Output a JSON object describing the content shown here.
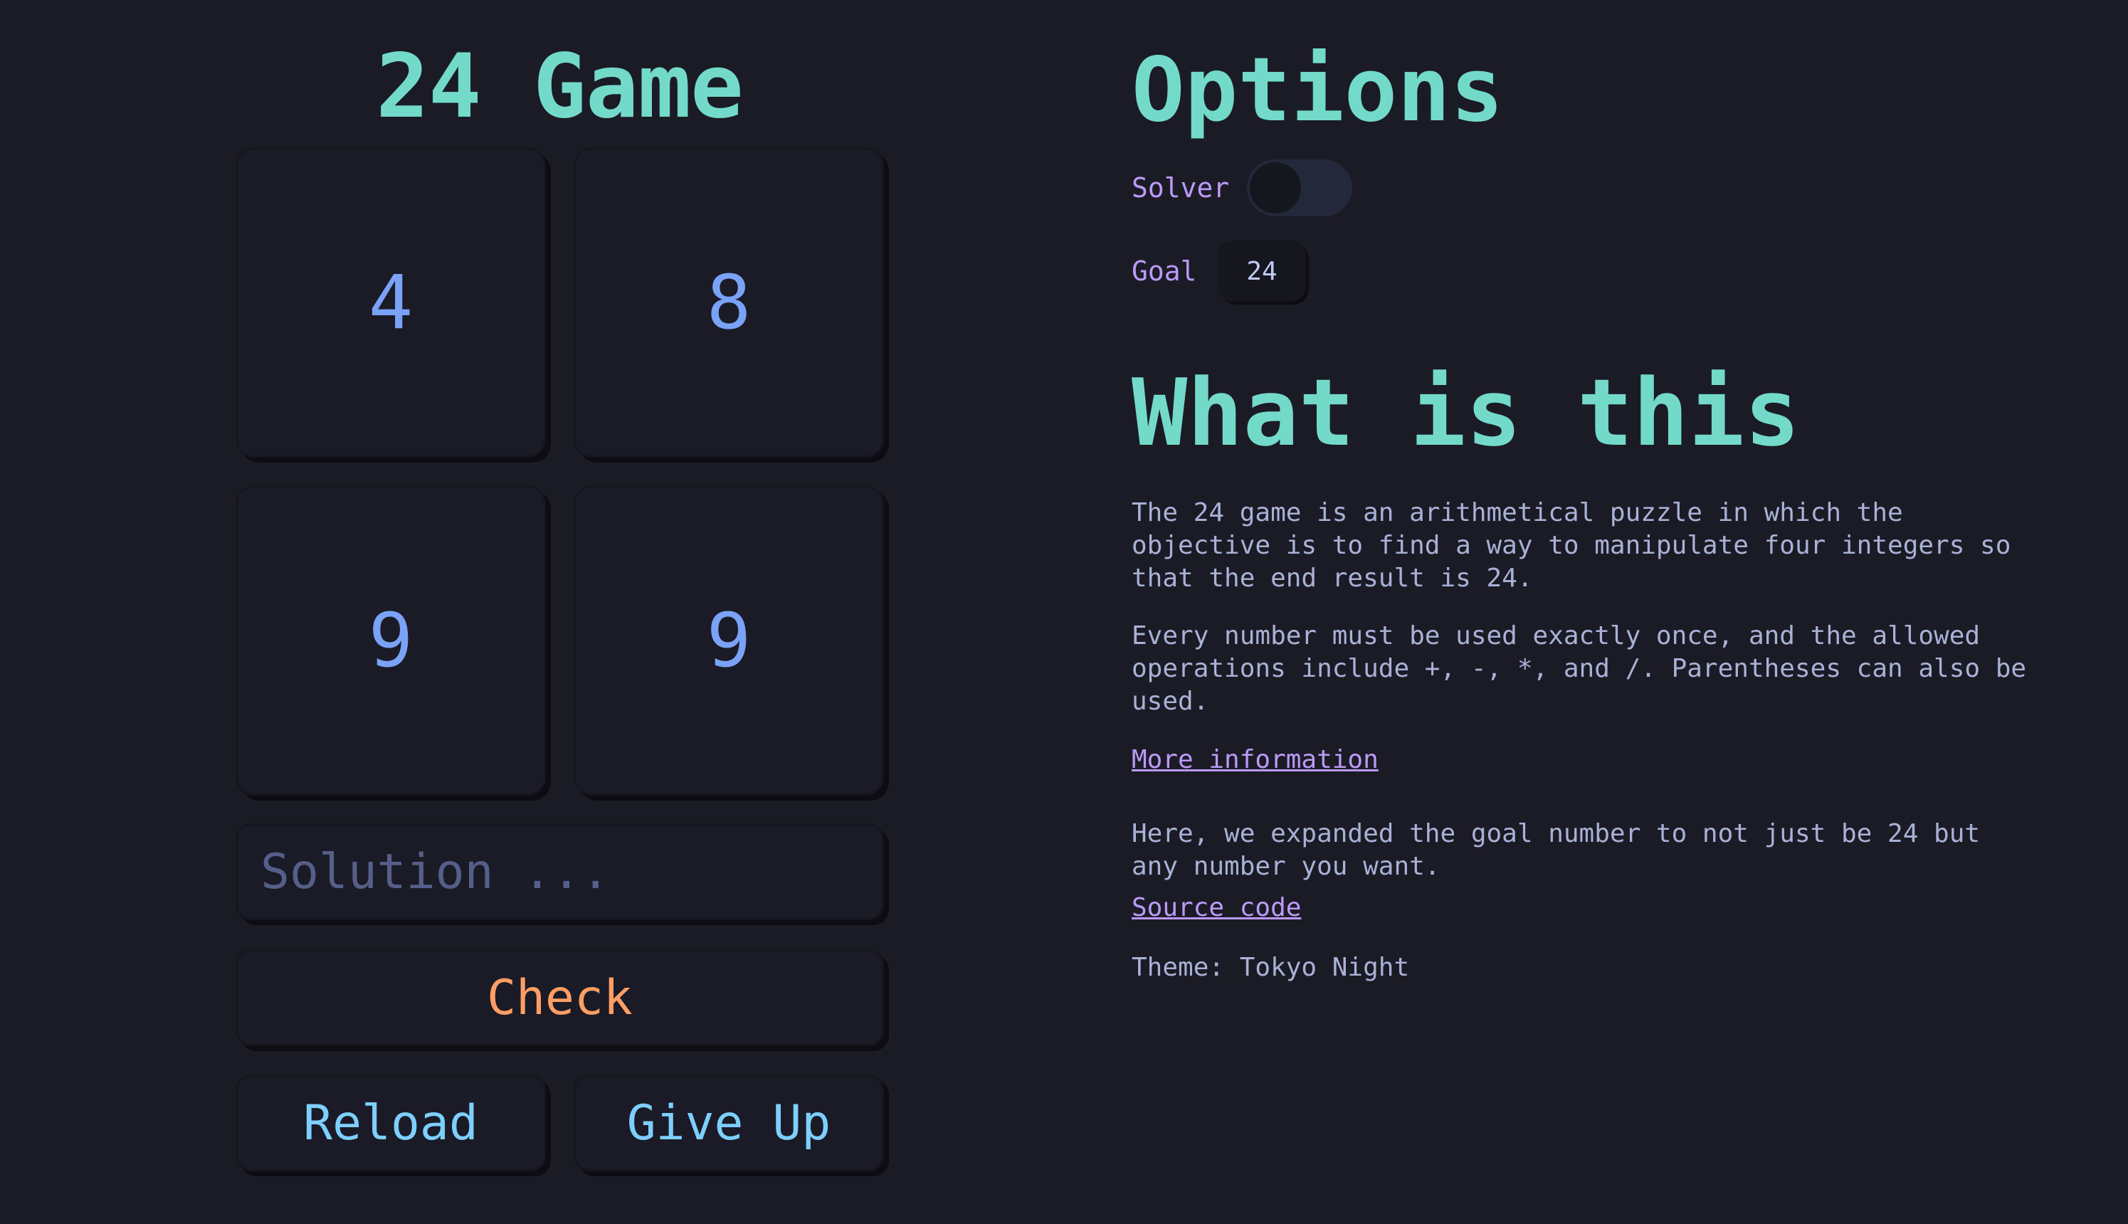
{
  "game": {
    "title": "24 Game",
    "cards": [
      "4",
      "8",
      "9",
      "9"
    ],
    "solution_placeholder": "Solution ...",
    "solution_value": "",
    "check_label": "Check",
    "reload_label": "Reload",
    "giveup_label": "Give Up"
  },
  "options": {
    "title": "Options",
    "solver_label": "Solver",
    "solver_enabled": false,
    "goal_label": "Goal",
    "goal_value": "24"
  },
  "about": {
    "title": "What is this",
    "paragraph1": "The 24 game is an arithmetical puzzle in which the objective is to find a way to manipulate four integers so that the end result is 24.",
    "paragraph2": "Every number must be used exactly once, and the allowed operations include +, -, *, and /. Parentheses can also be used.",
    "more_info_link": "More information",
    "paragraph3": "Here, we expanded the goal number to not just be 24 but any number you want.",
    "source_link": "Source code",
    "theme": "Theme: Tokyo Night"
  },
  "colors": {
    "background": "#1b1b26",
    "heading": "#73daca",
    "card_number": "#7aa2f7",
    "check_button": "#ff9e64",
    "action_buttons": "#7dcfff",
    "label": "#bb9af7",
    "body_text": "#a9b1d6"
  }
}
